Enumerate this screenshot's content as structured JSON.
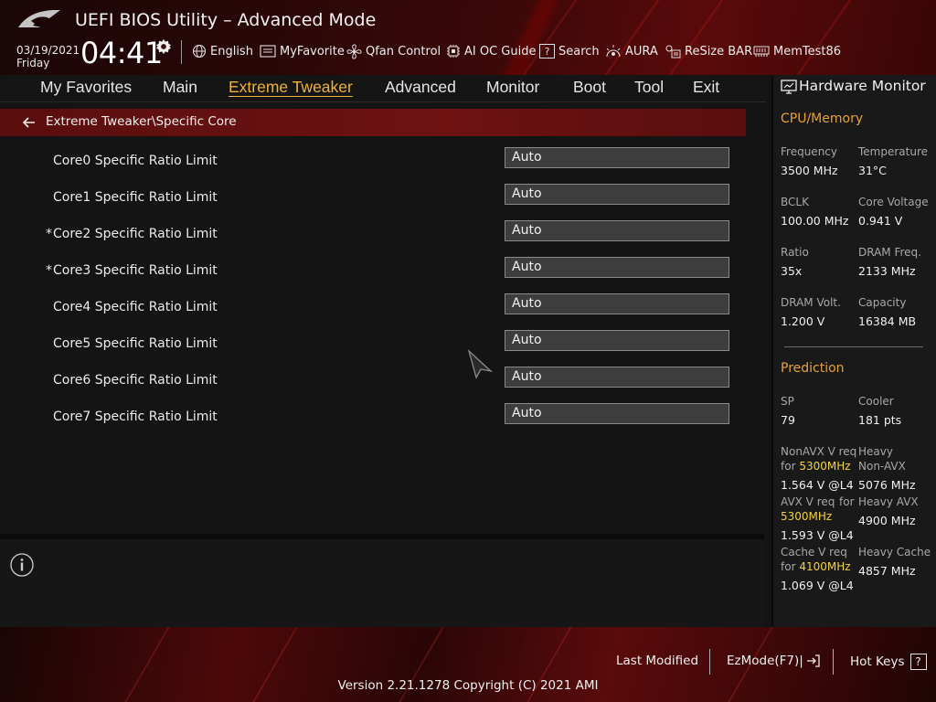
{
  "header": {
    "title": "UEFI BIOS Utility – Advanced Mode",
    "date": "03/19/2021",
    "day": "Friday",
    "time": "04:41",
    "toolbar": [
      {
        "label": "English",
        "icon": "globe-icon"
      },
      {
        "label": "MyFavorite",
        "icon": "favorite-icon"
      },
      {
        "label": "Qfan Control",
        "icon": "fan-icon"
      },
      {
        "label": "AI OC Guide",
        "icon": "chip-icon"
      },
      {
        "label": "Search",
        "icon": "search-icon"
      },
      {
        "label": "AURA",
        "icon": "aura-icon"
      },
      {
        "label": "ReSize BAR",
        "icon": "resize-bar-icon"
      },
      {
        "label": "MemTest86",
        "icon": "memory-icon"
      }
    ]
  },
  "nav": {
    "tabs": [
      "My Favorites",
      "Main",
      "Extreme Tweaker",
      "Advanced",
      "Monitor",
      "Boot",
      "Tool",
      "Exit"
    ],
    "active": "Extreme Tweaker"
  },
  "breadcrumb": "Extreme Tweaker\\Specific Core",
  "settings": [
    {
      "label": "Core0 Specific Ratio Limit",
      "value": "Auto",
      "modified": false
    },
    {
      "label": "Core1 Specific Ratio Limit",
      "value": "Auto",
      "modified": false
    },
    {
      "label": "Core2 Specific Ratio Limit",
      "value": "Auto",
      "modified": true
    },
    {
      "label": "Core3 Specific Ratio Limit",
      "value": "Auto",
      "modified": true
    },
    {
      "label": "Core4 Specific Ratio Limit",
      "value": "Auto",
      "modified": false
    },
    {
      "label": "Core5 Specific Ratio Limit",
      "value": "Auto",
      "modified": false
    },
    {
      "label": "Core6 Specific Ratio Limit",
      "value": "Auto",
      "modified": false
    },
    {
      "label": "Core7 Specific Ratio Limit",
      "value": "Auto",
      "modified": false
    }
  ],
  "hardware_monitor": {
    "title": "Hardware Monitor",
    "cpu_memory": {
      "title": "CPU/Memory",
      "frequency_label": "Frequency",
      "frequency": "3500 MHz",
      "temperature_label": "Temperature",
      "temperature": "31°C",
      "bclk_label": "BCLK",
      "bclk": "100.00 MHz",
      "core_voltage_label": "Core Voltage",
      "core_voltage": "0.941 V",
      "ratio_label": "Ratio",
      "ratio": "35x",
      "dram_freq_label": "DRAM Freq.",
      "dram_freq": "2133 MHz",
      "dram_volt_label": "DRAM Volt.",
      "dram_volt": "1.200 V",
      "capacity_label": "Capacity",
      "capacity": "16384 MB"
    },
    "prediction": {
      "title": "Prediction",
      "sp_label": "SP",
      "sp": "79",
      "cooler_label": "Cooler",
      "cooler": "181 pts",
      "nonavx_label_1": "NonAVX V req",
      "nonavx_for": "for",
      "nonavx_freq": "5300MHz",
      "nonavx_value": "1.564 V @L4",
      "heavy_nonavx_label_1": "Heavy",
      "heavy_nonavx_label_2": "Non-AVX",
      "heavy_nonavx": "5076 MHz",
      "avx_label": "AVX V req",
      "avx_for": "for",
      "avx_freq": "5300MHz",
      "avx_value": "1.593 V @L4",
      "heavy_avx_label": "Heavy AVX",
      "heavy_avx": "4900 MHz",
      "cache_label": "Cache V req",
      "cache_for": "for",
      "cache_freq": "4100MHz",
      "cache_value": "1.069 V @L4",
      "heavy_cache_label": "Heavy Cache",
      "heavy_cache": "4857 MHz"
    }
  },
  "footer": {
    "last_modified": "Last Modified",
    "ezmode": "EzMode(F7)|",
    "hot_keys": "Hot Keys",
    "hot_keys_key": "?",
    "version": "Version 2.21.1278 Copyright (C) 2021 AMI"
  },
  "colors": {
    "accent": "#f0b13a",
    "highlight": "#f4d23c",
    "crumb_bar": "#6e1212",
    "brand_red": "#5a0a0a"
  }
}
